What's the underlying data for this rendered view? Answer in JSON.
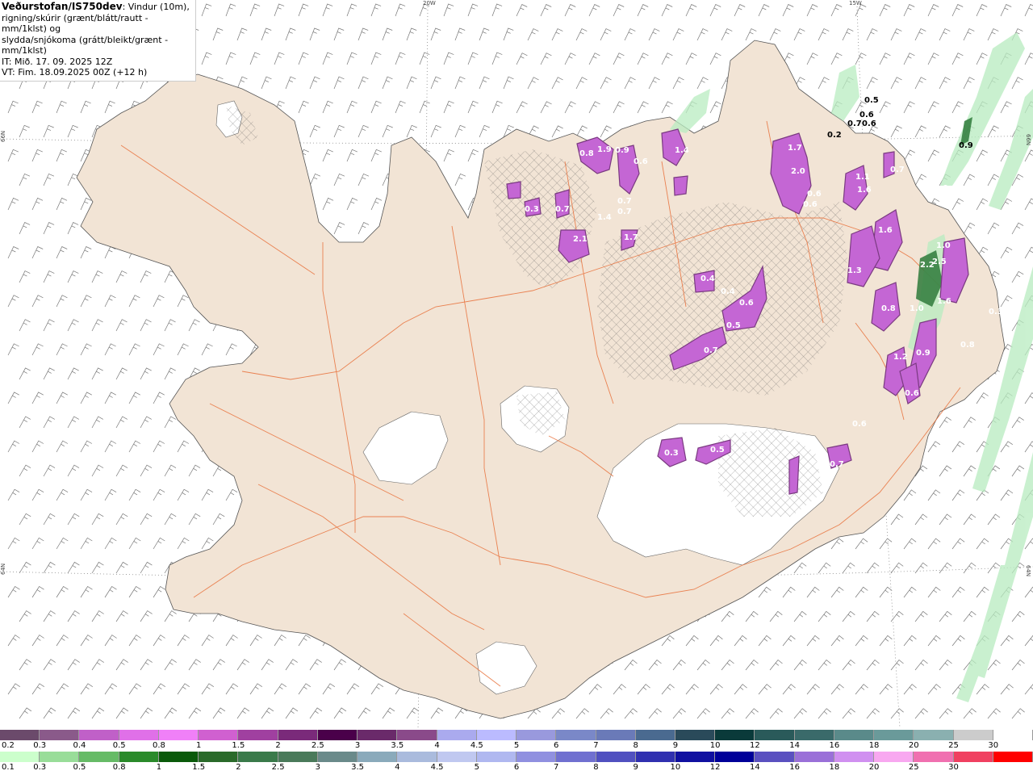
{
  "header": {
    "title_strong": "Veðurstofan/IS750dev",
    "title_rest": ": Vindur (10m),",
    "line2": "rigning/skúrir (grænt/blátt/rautt - mm/1klst) og",
    "line3": "slydda/snjókoma (grátt/bleikt/grænt - mm/1klst)",
    "line4": "IT: Mið. 17. 09. 2025 12Z",
    "line5": "VT: Fim. 18.09.2025 00Z (+12 h)"
  },
  "map": {
    "land_color": "#f2e4d5",
    "ice_color": "#ffffff",
    "road_color": "#e8703a",
    "coast_color": "#555555",
    "coords": {
      "lon_20w": "20W",
      "lon_15w": "15W",
      "lat_66n_left": "66N",
      "lat_66n_right": "66N",
      "lat_64n_left": "64N",
      "lat_64n_right": "64N"
    },
    "value_labels": [
      "0.8",
      "1.9",
      "0.9",
      "0.6",
      "1.4",
      "1.7",
      "2.0",
      "0.5",
      "0.6",
      "0.7",
      "0.6",
      "0.2",
      "0.9",
      "0.7",
      "0.3",
      "0.7",
      "0.7",
      "1.4",
      "0.6",
      "1.1",
      "1.6",
      "0.6",
      "0.7",
      "0.6",
      "0.4",
      "2.1",
      "1.7",
      "1.0",
      "1.6",
      "1.3",
      "2.2",
      "2.5",
      "0.4",
      "0.6",
      "0.8",
      "1.0",
      "1.6",
      "0.3",
      "0.5",
      "0.7",
      "0.8",
      "1.2",
      "0.9",
      "0.6",
      "0.3",
      "0.5",
      "0.7",
      "0.6",
      "0.7"
    ]
  },
  "scale_rain": {
    "colors": [
      "#6b4a6b",
      "#8a5a8a",
      "#c060c8",
      "#e070e8",
      "#f080f8",
      "#d060d0",
      "#a040a0",
      "#7a2a7a",
      "#4a004a",
      "#6a2a6a",
      "#8a4a8a",
      "#aaaaee",
      "#bbbbff",
      "#9999dd",
      "#7a88c8",
      "#6a7ab8",
      "#4a6a90",
      "#2a4a5a",
      "#0a3a3a",
      "#2a5a5a",
      "#3a6a6a",
      "#5a8a8a",
      "#6a9a9a",
      "#8ab0b0",
      "#cccccc",
      "#ffffff"
    ],
    "labels": [
      "0.2",
      "0.3",
      "0.4",
      "0.5",
      "0.8",
      "1",
      "1.5",
      "2",
      "2.5",
      "3",
      "3.5",
      "4",
      "4.5",
      "5",
      "6",
      "7",
      "8",
      "9",
      "10",
      "12",
      "14",
      "16",
      "18",
      "20",
      "25",
      "30"
    ]
  },
  "scale_snow": {
    "colors": [
      "#ccffcc",
      "#99dd99",
      "#66bb66",
      "#2a8a2a",
      "#0a5a0a",
      "#2a6a2a",
      "#3a7a4a",
      "#4a7a5a",
      "#6a8a8a",
      "#8aaabb",
      "#aabbdd",
      "#c0c8f0",
      "#b0b8f0",
      "#9090e0",
      "#7070d0",
      "#5050c0",
      "#3030b0",
      "#1010a0",
      "#000099",
      "#5a50c0",
      "#9a70d8",
      "#d090f0",
      "#f8a8f0",
      "#f070b0",
      "#f04060",
      "#ff0000"
    ],
    "labels": [
      "0.1",
      "0.3",
      "0.5",
      "0.8",
      "1",
      "1.5",
      "2",
      "2.5",
      "3",
      "3.5",
      "4",
      "4.5",
      "5",
      "6",
      "7",
      "8",
      "9",
      "10",
      "12",
      "14",
      "16",
      "18",
      "20",
      "25",
      "30"
    ]
  }
}
